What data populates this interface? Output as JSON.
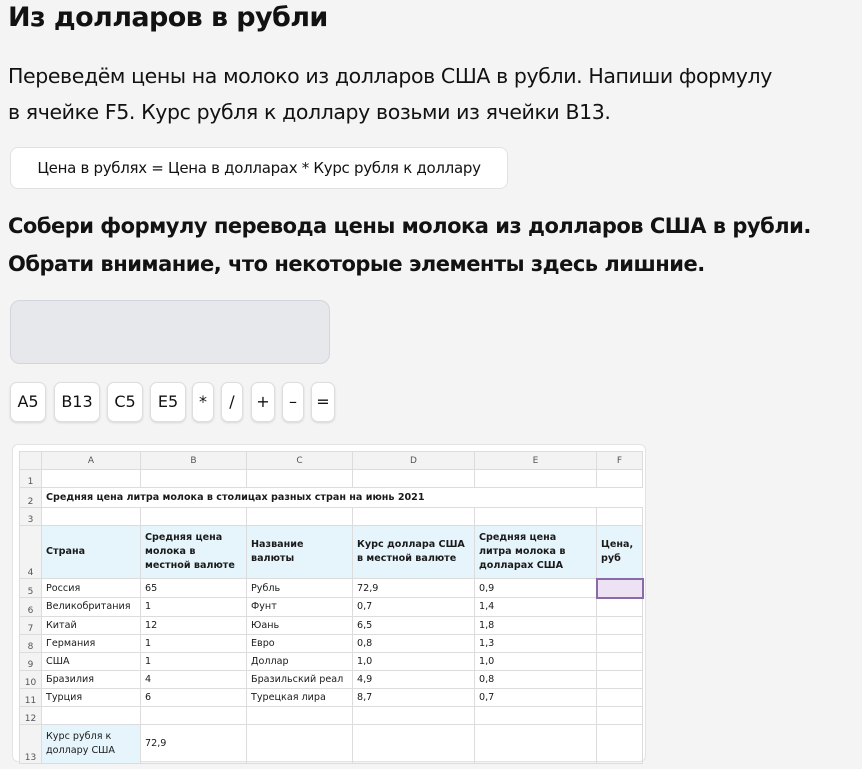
{
  "title": "Из долларов в рубли",
  "description_line1": "Переведём цены на молоко из долларов США в рубли. Напиши формулу",
  "description_line2": "в ячейке F5. Курс рубля к доллару возьми из ячейки B13.",
  "formula_hint": "Цена в рублях = Цена в долларах * Курс рубля к доллару",
  "task_line1": "Собери формулу перевода цены молока из долларов США в рубли.",
  "task_line2": "Обрати внимание, что некоторые элементы здесь лишние.",
  "tokens": [
    "A5",
    "B13",
    "C5",
    "E5",
    "*",
    "/",
    "+",
    "–",
    "="
  ],
  "sheet": {
    "columns": [
      "A",
      "B",
      "C",
      "D",
      "E",
      "F"
    ],
    "row_numbers": [
      "1",
      "2",
      "3",
      "4",
      "5",
      "6",
      "7",
      "8",
      "9",
      "10",
      "11",
      "12",
      "13"
    ],
    "table_title": "Средняя цена литра молока в столицах разных стран на июнь 2021",
    "headers": [
      "Страна",
      "Средняя цена молока в местной валюте",
      "Название валюты",
      "Курс доллара США в местной валюте",
      "Средняя цена литра молока в долларах США",
      "Цена, руб"
    ],
    "rows": [
      [
        "Россия",
        "65",
        "Рубль",
        "72,9",
        "0,9",
        ""
      ],
      [
        "Великобритания",
        "1",
        "Фунт",
        "0,7",
        "1,4",
        ""
      ],
      [
        "Китай",
        "12",
        "Юань",
        "6,5",
        "1,8",
        ""
      ],
      [
        "Германия",
        "1",
        "Евро",
        "0,8",
        "1,3",
        ""
      ],
      [
        "США",
        "1",
        "Доллар",
        "1,0",
        "1,0",
        ""
      ],
      [
        "Бразилия",
        "4",
        "Бразильский реал",
        "4,9",
        "0,8",
        ""
      ],
      [
        "Турция",
        "6",
        "Турецкая лира",
        "8,7",
        "0,7",
        ""
      ]
    ],
    "rate_label": "Курс рубля к доллару США",
    "rate_value": "72,9"
  },
  "colors": {
    "header_fill": "#e6f5fb",
    "selected_cell": "#ece2f4",
    "dropzone": "#e6e8ec"
  }
}
